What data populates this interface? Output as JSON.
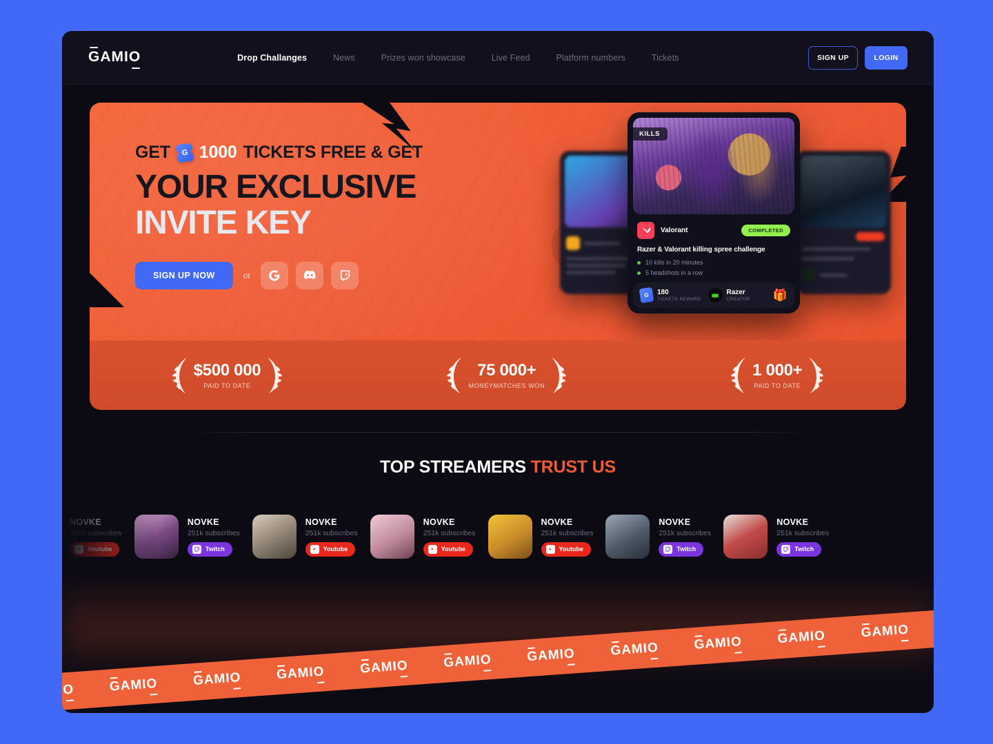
{
  "brand": {
    "logo_text": "GAMIO"
  },
  "nav": {
    "links": [
      {
        "label": "Drop Challanges",
        "active": true
      },
      {
        "label": "News",
        "active": false
      },
      {
        "label": "Prizes won showcase",
        "active": false
      },
      {
        "label": "Live Feed",
        "active": false
      },
      {
        "label": "Platform numbers",
        "active": false
      },
      {
        "label": "Tickets",
        "active": false
      }
    ],
    "signup_label": "SIGN UP",
    "login_label": "LOGIN"
  },
  "hero": {
    "eyebrow_pre": "GET",
    "eyebrow_num": "1000",
    "eyebrow_post": "TICKETS FREE & GET",
    "headline_line1": "YOUR EXCLUSIVE",
    "headline_line2": "INVITE KEY",
    "cta_label": "SIGN UP NOW",
    "or_label": "or",
    "socials": [
      {
        "name": "google-icon"
      },
      {
        "name": "discord-icon"
      },
      {
        "name": "twitch-icon"
      }
    ]
  },
  "challenge_card": {
    "category_badge": "KILLS",
    "game": "Valorant",
    "status": "COMPLETED",
    "title": "Razer & Valorant killing spree challenge",
    "objectives": [
      "10 kills in 20 minutes",
      "5 headshots in a row"
    ],
    "reward_value": "180",
    "reward_label": "TICKETS REWARD",
    "creator_name": "Razer",
    "creator_label": "CREATOR",
    "gift_icon": "gift-box-icon"
  },
  "stats": [
    {
      "value": "$500 000",
      "label": "PAID TO DATE"
    },
    {
      "value": "75 000+",
      "label": "MONEYMATCHES WON"
    },
    {
      "value": "1 000+",
      "label": "PAID TO DATE"
    }
  ],
  "streamers_section": {
    "title_white": "TOP STREAMERS",
    "title_accent": "TRUST US",
    "items": [
      {
        "name": "NOVKE",
        "subs": "251k subscribes",
        "platform": "Youtube",
        "platform_class": "youtube",
        "avatar": "linear-gradient(150deg,#b07cc0,#58324f 55%,#2b1c2e)"
      },
      {
        "name": "NOVKE",
        "subs": "251k subscribes",
        "platform": "Twitch",
        "platform_class": "twitch",
        "avatar": "linear-gradient(150deg,#d9a8cf,#7b4a86 50%,#33203a)"
      },
      {
        "name": "NOVKE",
        "subs": "251k subscribes",
        "platform": "Youtube",
        "platform_class": "youtube",
        "avatar": "linear-gradient(150deg,#d8cdbb,#8b8071 55%,#4c4439)"
      },
      {
        "name": "NOVKE",
        "subs": "251k subscribes",
        "platform": "Youtube",
        "platform_class": "youtube",
        "avatar": "linear-gradient(150deg,#f0cdd7,#c08a9c 55%,#6d4352)"
      },
      {
        "name": "NOVKE",
        "subs": "251k subscribes",
        "platform": "Youtube",
        "platform_class": "youtube",
        "avatar": "linear-gradient(150deg,#f2c23a,#c98c2a 55%,#7a5018)"
      },
      {
        "name": "NOVKE",
        "subs": "251k subscribes",
        "platform": "Twitch",
        "platform_class": "twitch",
        "avatar": "linear-gradient(150deg,#9aa6b4,#4e5a68 55%,#272f3a)"
      },
      {
        "name": "NOVKE",
        "subs": "251k subscribes",
        "platform": "Twitch",
        "platform_class": "twitch",
        "avatar": "linear-gradient(150deg,#e8e3da,#c24a4a 50%,#8a2f2f)"
      }
    ]
  },
  "marquee": {
    "logo_text": "GAMIO",
    "repeat": 11
  },
  "colors": {
    "page_bg": "#4169f5",
    "app_bg": "#0c0b14",
    "hero_orange": "#ee5b36",
    "accent_blue": "#4169f5",
    "status_green": "#93ef4e",
    "twitch_purple": "#7a34e0",
    "youtube_red": "#e8281b"
  }
}
